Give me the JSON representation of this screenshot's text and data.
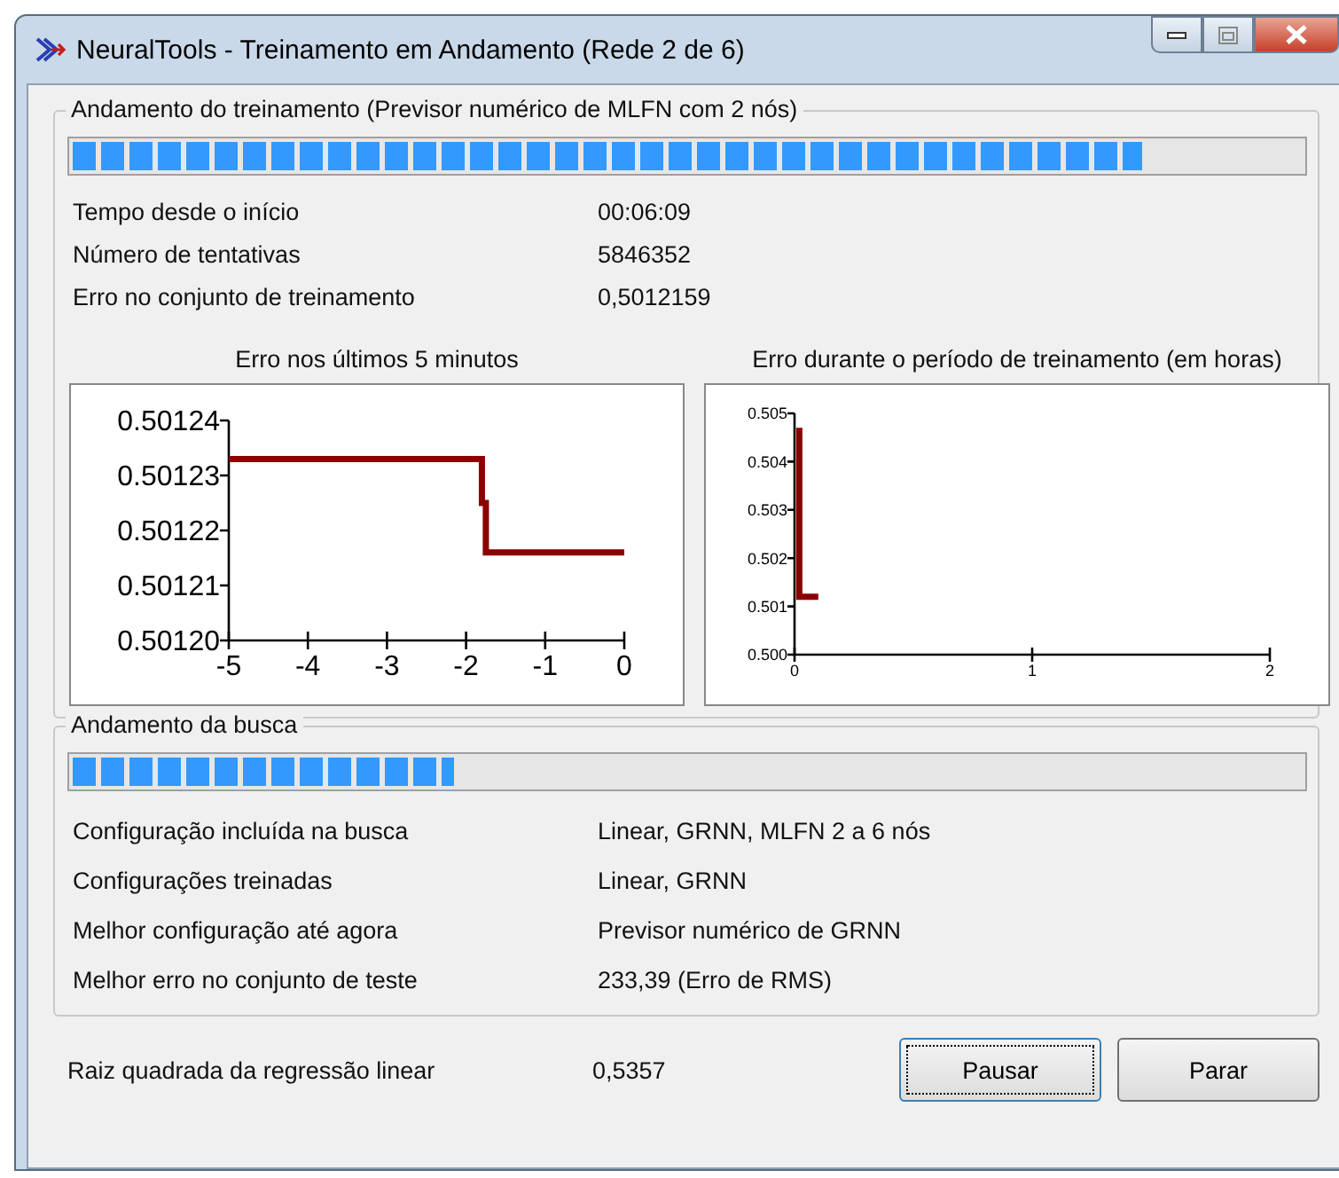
{
  "window": {
    "title": "NeuralTools - Treinamento em Andamento (Rede 2 de 6)"
  },
  "training": {
    "legend": "Andamento do treinamento (Previsor numérico de MLFN com 2 nós)",
    "level": 0.87,
    "rows": [
      {
        "label": "Tempo desde o início",
        "value": "00:06:09"
      },
      {
        "label": "Número de tentativas",
        "value": "5846352"
      },
      {
        "label": "Erro no conjunto de treinamento",
        "value": "0,5012159"
      }
    ],
    "charts": [
      {
        "title": "Erro nos últimos 5 minutos",
        "chart_data": {
          "type": "line",
          "x": [
            -5,
            -1.8,
            -1.8,
            -1.75,
            -1.75,
            0
          ],
          "series": [
            {
              "color": "#8b0000",
              "values": [
                0.501233,
                0.501233,
                0.501225,
                0.501225,
                0.501216,
                0.501216
              ]
            }
          ],
          "xlim": [
            -5,
            0
          ],
          "ylim": [
            0.5012,
            0.50124
          ],
          "xticks": [
            -5,
            -4,
            -3,
            -2,
            -1,
            0
          ],
          "yticks": [
            {
              "value": 0.5012,
              "label": "0.50120"
            },
            {
              "value": 0.50121,
              "label": "0.50121"
            },
            {
              "value": 0.50122,
              "label": "0.50122"
            },
            {
              "value": 0.50123,
              "label": "0.50123"
            },
            {
              "value": 0.50124,
              "label": "0.50124"
            }
          ]
        }
      },
      {
        "title": "Erro durante o período de treinamento (em horas)",
        "chart_data": {
          "type": "line",
          "x": [
            0.02,
            0.02,
            0.1
          ],
          "series": [
            {
              "color": "#8b0000",
              "values": [
                0.5047,
                0.5012,
                0.5012
              ]
            }
          ],
          "xlim": [
            0,
            2
          ],
          "ylim": [
            0.5,
            0.505
          ],
          "xticks": [
            0,
            1,
            2
          ],
          "yticks": [
            {
              "value": 0.5,
              "label": "0.500"
            },
            {
              "value": 0.501,
              "label": "0.501"
            },
            {
              "value": 0.502,
              "label": "0.502"
            },
            {
              "value": 0.503,
              "label": "0.503"
            },
            {
              "value": 0.504,
              "label": "0.504"
            },
            {
              "value": 0.505,
              "label": "0.505"
            }
          ]
        }
      }
    ]
  },
  "search": {
    "legend": "Andamento da busca",
    "level": 0.31,
    "rows": [
      {
        "label": "Configuração incluída na busca",
        "value": "Linear, GRNN, MLFN 2 a 6 nós"
      },
      {
        "label": "Configurações treinadas",
        "value": "Linear, GRNN"
      },
      {
        "label": "Melhor configuração até agora",
        "value": "Previsor numérico de GRNN"
      },
      {
        "label": "Melhor erro no conjunto de teste",
        "value": "233,39 (Erro de RMS)"
      }
    ]
  },
  "footer": {
    "label": "Raiz quadrada da regressão linear",
    "value": "0,5357"
  },
  "buttons": [
    {
      "label": "Pausar",
      "focused": true
    },
    {
      "label": "Parar",
      "focused": false
    }
  ]
}
